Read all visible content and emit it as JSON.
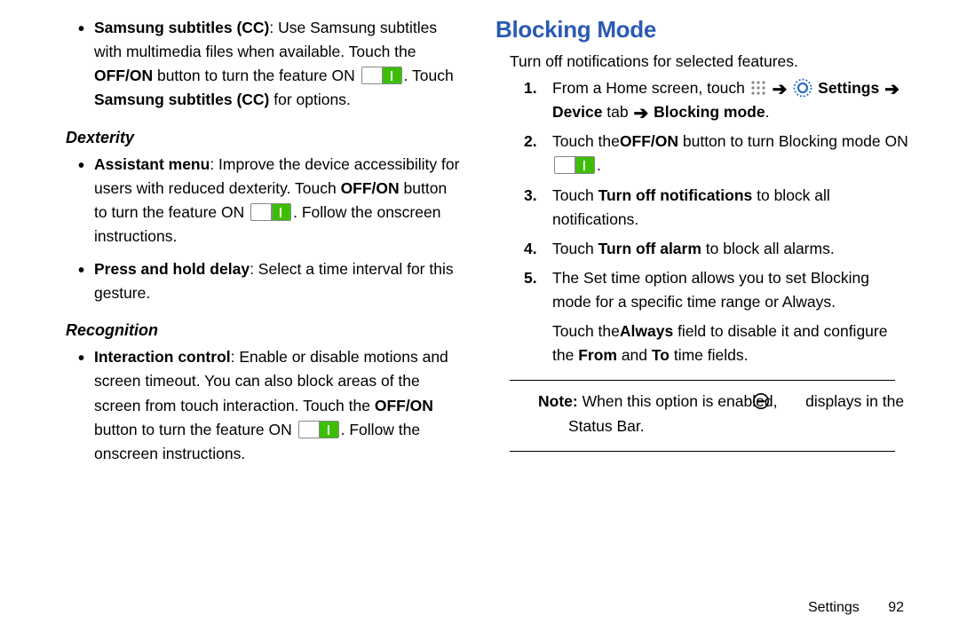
{
  "left": {
    "bullet1": {
      "lead": "Samsung subtitles (CC)",
      "t1": ": Use Samsung subtitles with multimedia files when available. Touch the ",
      "b1": "OFF/ON",
      "t2": " button to turn the feature ON ",
      "t3": ". Touch ",
      "b2": "Samsung subtitles (CC)",
      "t4": " for options."
    },
    "sub1": "Dexterity",
    "bullet2": {
      "lead": "Assistant menu",
      "t1": ": Improve the device accessibility for users with reduced dexterity. Touch ",
      "b1": "OFF/ON",
      "t2": " button to turn the feature ON ",
      "t3": ". Follow the onscreen instructions."
    },
    "bullet3": {
      "lead": "Press and hold delay",
      "t1": ": Select a time interval for this gesture."
    },
    "sub2": "Recognition",
    "bullet4": {
      "lead": "Interaction control",
      "t1": ": Enable or disable motions and screen timeout. You can also block areas of the screen from touch interaction. Touch the ",
      "b1": "OFF/ON",
      "t2": " button to turn the feature ON ",
      "t3": ". Follow the onscreen instructions."
    }
  },
  "right": {
    "heading": "Blocking Mode",
    "intro": "Turn off notifications for selected features.",
    "arrow": "➔",
    "step1": {
      "t1": "From a Home screen, touch ",
      "b1": "Settings",
      "b2": "Device",
      "t2": " tab ",
      "b3": "Blocking mode",
      "t3": "."
    },
    "step2": {
      "t1": "Touch the",
      "b1": "OFF/ON",
      "t2": "  button to turn Blocking mode ON ",
      "t3": "."
    },
    "step3": {
      "t1": "Touch ",
      "b1": "Turn off notifications",
      "t2": " to block all notifications."
    },
    "step4": {
      "t1": "Touch ",
      "b1": "Turn off alarm",
      "t2": " to block all alarms."
    },
    "step5": {
      "t1": "The Set time option allows you to set Blocking mode for a specific time range or Always."
    },
    "after": {
      "t1": "Touch the",
      "b1": "Always",
      "t2": "  field to disable it and configure the ",
      "b2": "From",
      "t3": " and ",
      "b3": "To",
      "t4": " time fields."
    },
    "note": {
      "lead": "Note:",
      "t1": " When this option is enabled, ",
      "t2": " displays in the Status Bar."
    }
  },
  "footer": {
    "section": "Settings",
    "page": "92"
  }
}
